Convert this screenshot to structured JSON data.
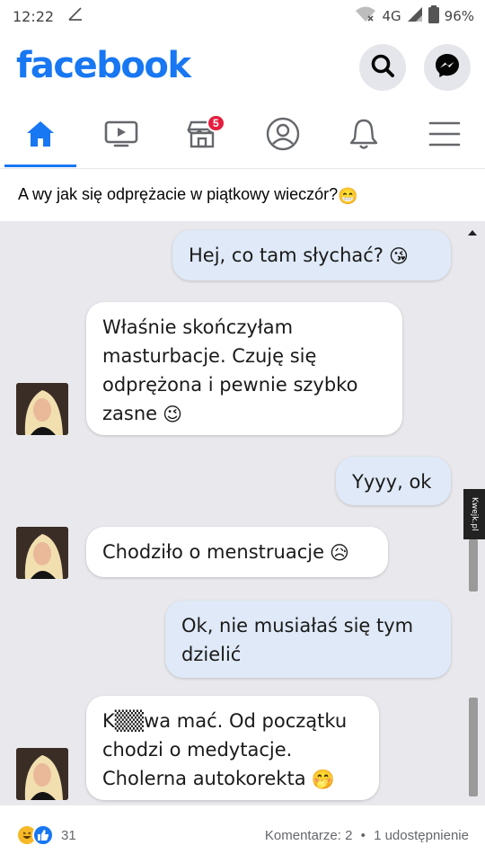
{
  "status_bar": {
    "time": "12:22",
    "network": "4G",
    "battery": "96%"
  },
  "header": {
    "logo": "facebook",
    "search_icon": "search-icon",
    "messenger_icon": "messenger-icon"
  },
  "nav": {
    "tabs": [
      {
        "name": "home",
        "icon": "home-icon",
        "active": true
      },
      {
        "name": "watch",
        "icon": "video-icon",
        "active": false
      },
      {
        "name": "marketplace",
        "icon": "store-icon",
        "active": false,
        "badge": "5"
      },
      {
        "name": "profile",
        "icon": "profile-icon",
        "active": false
      },
      {
        "name": "notifications",
        "icon": "bell-icon",
        "active": false
      },
      {
        "name": "menu",
        "icon": "hamburger-icon",
        "active": false
      }
    ]
  },
  "post": {
    "text": "A wy jak się odprężacie w piątkowy wieczór?",
    "emoji": "😁"
  },
  "chat": {
    "messages": [
      {
        "side": "out",
        "lines": [
          "Hej, co tam słychać?"
        ],
        "emoji": "😘"
      },
      {
        "side": "in",
        "lines": [
          "Właśnie skończyłam",
          "masturbacje. Czuję się",
          "odprężona i pewnie szybko",
          "zasne"
        ],
        "emoji": "😉"
      },
      {
        "side": "out",
        "lines": [
          "Yyyy, ok"
        ]
      },
      {
        "side": "in",
        "lines": [
          "Chodziło o menstruacje"
        ],
        "emoji": "😥"
      },
      {
        "side": "out",
        "lines": [
          "Ok, nie musiałaś się tym",
          "dzielić"
        ]
      },
      {
        "side": "in",
        "lines": [
          "K▒▒wa mać. Od początku",
          "chodzi o medytacje.",
          "Cholerna autokorekta"
        ],
        "emoji": "🤭"
      }
    ],
    "watermark": "Kwejk.pl"
  },
  "footer": {
    "reaction_count": "31",
    "comments": "Komentarze: 2",
    "separator": "•",
    "shares": "1 udostępnienie"
  },
  "colors": {
    "brand": "#1877f2",
    "badge": "#e41e3f"
  }
}
